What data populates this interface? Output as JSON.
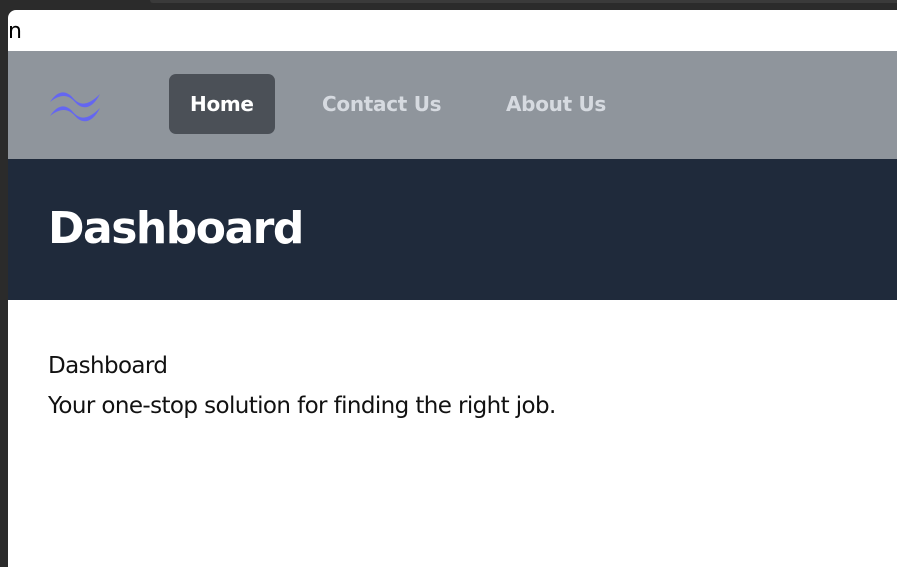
{
  "stray_text": "n",
  "navbar": {
    "logo_icon": "tailwind-wave-logo",
    "logo_color": "#6466f1",
    "items": [
      {
        "label": "Home",
        "active": true
      },
      {
        "label": "Contact Us",
        "active": false
      },
      {
        "label": "About Us",
        "active": false
      }
    ]
  },
  "header": {
    "title": "Dashboard"
  },
  "main": {
    "heading": "Dashboard",
    "subtitle": "Your one-stop solution for finding the right job."
  },
  "colors": {
    "navbar_bg": "#8f959c",
    "active_tab_bg": "#4b5057",
    "header_bg": "#1f2a3b"
  }
}
